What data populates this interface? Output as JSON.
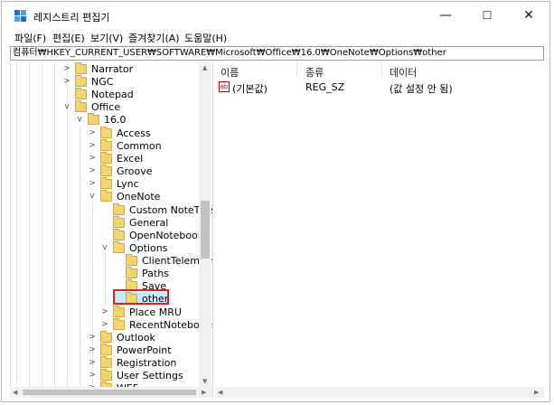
{
  "window": {
    "title": "레지스트리 편집기",
    "minimize": "—",
    "maximize": "☐",
    "close": "✕"
  },
  "menu": [
    "파일(F)",
    "편집(E)",
    "보기(V)",
    "즐겨찾기(A)",
    "도움말(H)"
  ],
  "address": "컴퓨터₩HKEY_CURRENT_USER₩SOFTWARE₩Microsoft₩Office₩16.0₩OneNote₩Options₩other",
  "tree": [
    {
      "label": "Narrator",
      "exp": ">"
    },
    {
      "label": "NGC",
      "exp": ">"
    },
    {
      "label": "Notepad",
      "exp": ""
    },
    {
      "label": "Office",
      "exp": "v"
    },
    {
      "label": "16.0",
      "exp": "v"
    },
    {
      "label": "Access",
      "exp": ">"
    },
    {
      "label": "Common",
      "exp": ">"
    },
    {
      "label": "Excel",
      "exp": ">"
    },
    {
      "label": "Groove",
      "exp": ">"
    },
    {
      "label": "Lync",
      "exp": ">"
    },
    {
      "label": "OneNote",
      "exp": "v"
    },
    {
      "label": "Custom NoteTags",
      "exp": ""
    },
    {
      "label": "General",
      "exp": ""
    },
    {
      "label": "OpenNotebooks",
      "exp": ""
    },
    {
      "label": "Options",
      "exp": "v"
    },
    {
      "label": "ClientTelemetry",
      "exp": ""
    },
    {
      "label": "Paths",
      "exp": ""
    },
    {
      "label": "Save",
      "exp": ""
    },
    {
      "label": "other",
      "exp": ""
    },
    {
      "label": "Place MRU",
      "exp": ">"
    },
    {
      "label": "RecentNotebooks",
      "exp": ">"
    },
    {
      "label": "Outlook",
      "exp": ">"
    },
    {
      "label": "PowerPoint",
      "exp": ">"
    },
    {
      "label": "Registration",
      "exp": ">"
    },
    {
      "label": "User Settings",
      "exp": ">"
    },
    {
      "label": "WEF",
      "exp": ">"
    }
  ],
  "list": {
    "headers": {
      "name": "이름",
      "type": "종류",
      "data": "데이터"
    },
    "rows": [
      {
        "name": "(기본값)",
        "type": "REG_SZ",
        "data": "(값 설정 안 됨)"
      }
    ]
  },
  "icons": {
    "app": "registry-editor-icon",
    "value": "string-value-icon",
    "folder": "folder-icon"
  },
  "colors": {
    "highlight_border": "#e02020",
    "folder": "#f6d36b"
  }
}
